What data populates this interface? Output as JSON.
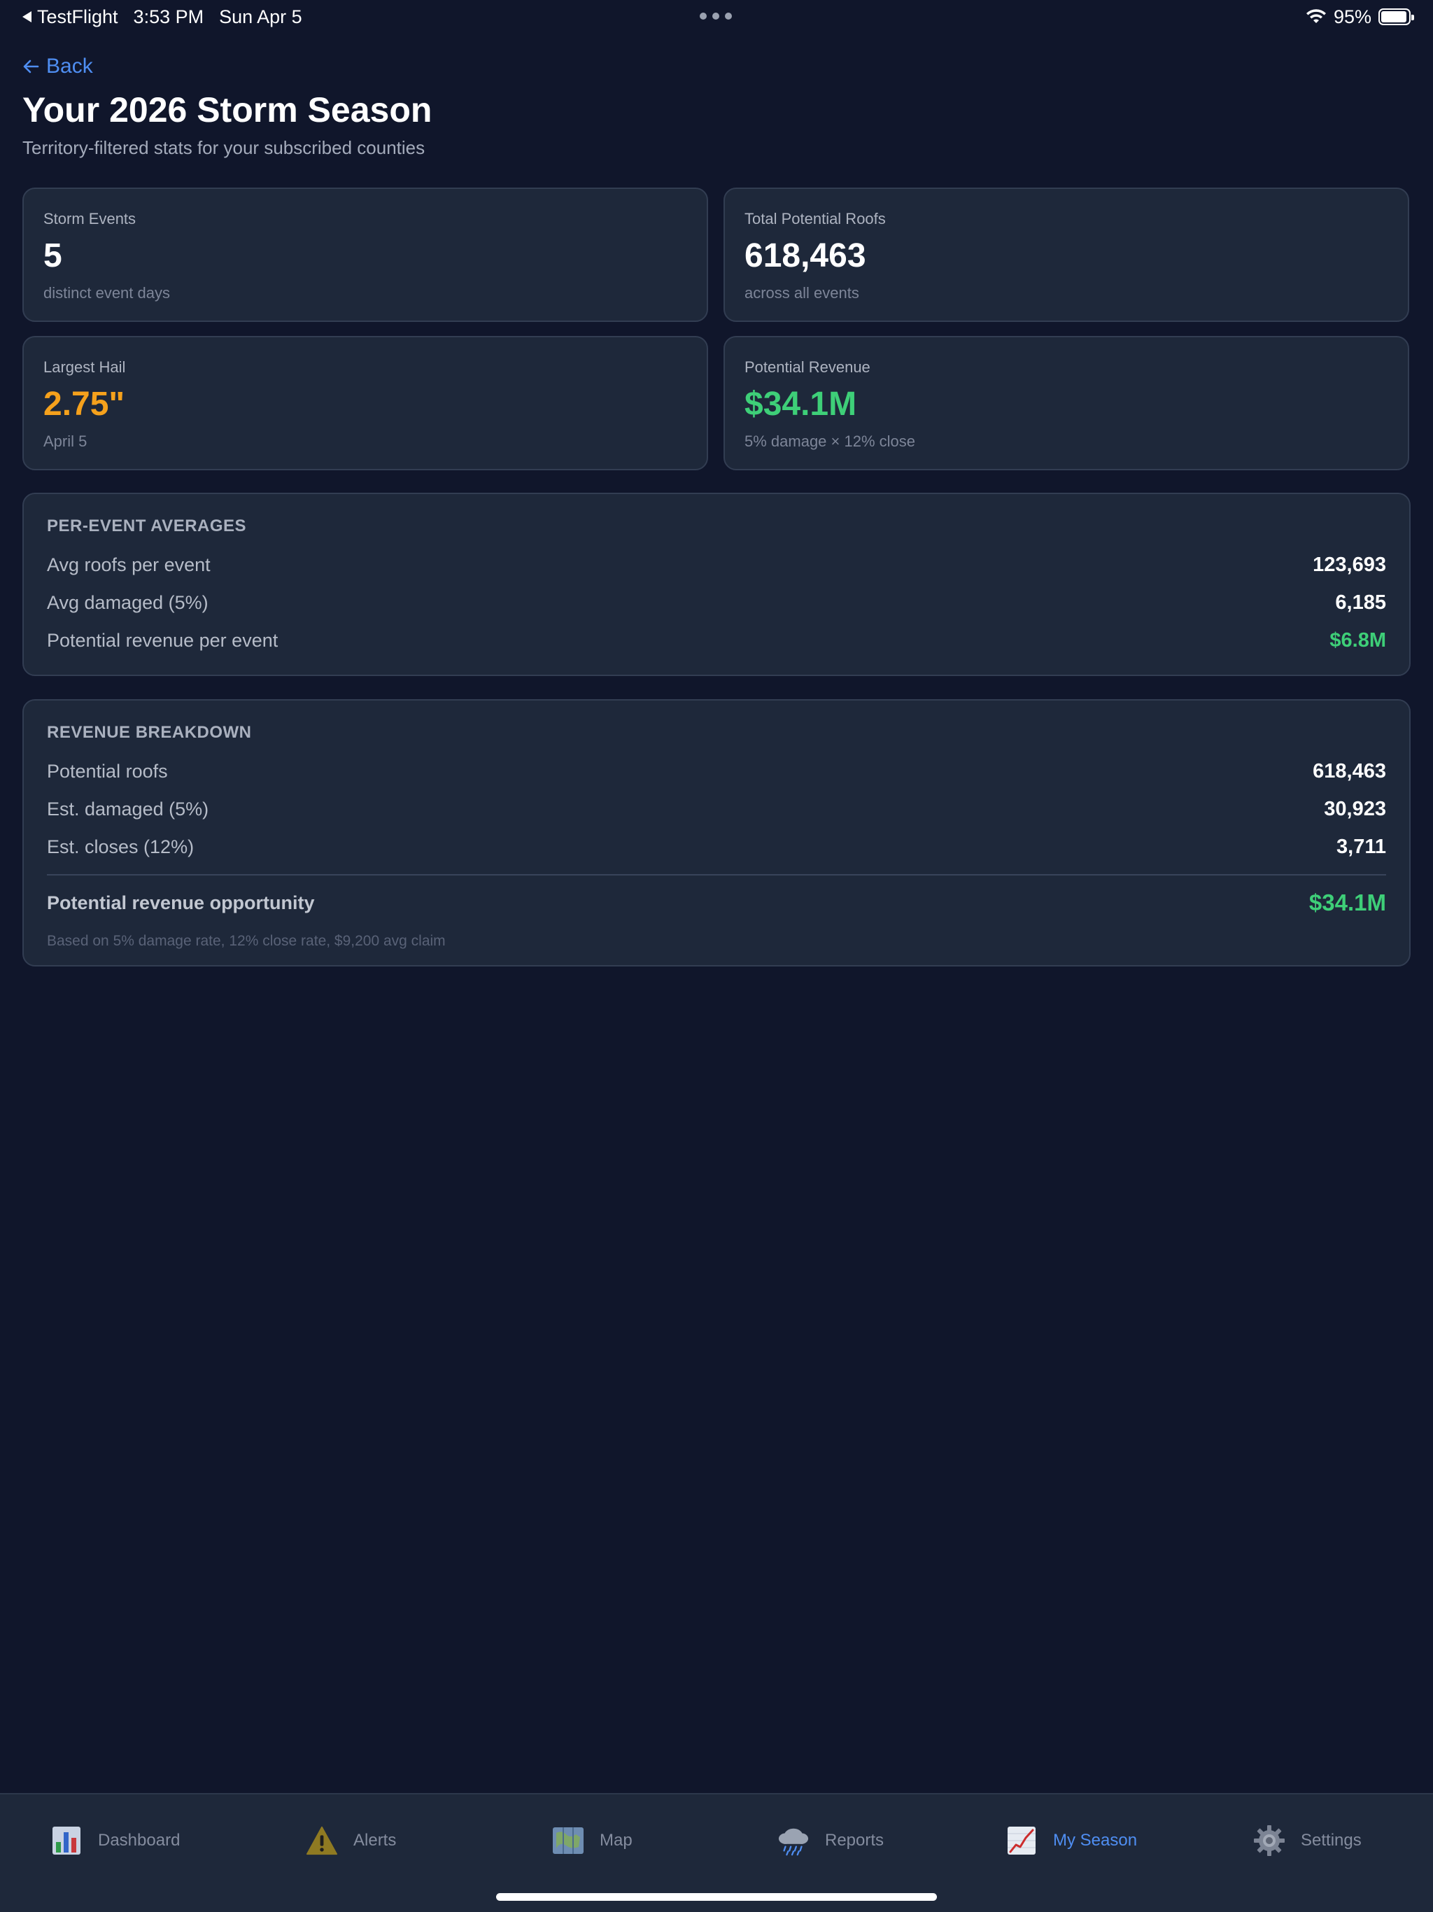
{
  "status_bar": {
    "app": "TestFlight",
    "time": "3:53 PM",
    "date": "Sun Apr 5",
    "battery": "95%",
    "battery_level": 0.95
  },
  "header": {
    "back_label": "Back",
    "title": "Your 2026 Storm Season",
    "subtitle": "Territory-filtered stats for your subscribed counties"
  },
  "stats": [
    {
      "label": "Storm Events",
      "value": "5",
      "note": "distinct event days"
    },
    {
      "label": "Total Potential Roofs",
      "value": "618,463",
      "note": "across all events"
    },
    {
      "label": "Largest Hail",
      "value": "2.75\"",
      "note": "April 5"
    },
    {
      "label": "Potential Revenue",
      "value": "$34.1M",
      "note": "5% damage × 12% close"
    }
  ],
  "per_event": {
    "heading": "PER-EVENT AVERAGES",
    "rows": [
      {
        "label": "Avg roofs per event",
        "value": "123,693"
      },
      {
        "label": "Avg damaged (5%)",
        "value": "6,185"
      },
      {
        "label": "Potential revenue per event",
        "value": "$6.8M"
      }
    ]
  },
  "revenue": {
    "heading": "REVENUE BREAKDOWN",
    "rows": [
      {
        "label": "Potential roofs",
        "value": "618,463"
      },
      {
        "label": "Est. damaged (5%)",
        "value": "30,923"
      },
      {
        "label": "Est. closes (12%)",
        "value": "3,711"
      }
    ],
    "total_label": "Potential revenue opportunity",
    "total_value": "$34.1M",
    "footnote": "Based on 5% damage rate, 12% close rate, $9,200 avg claim"
  },
  "tabs": [
    {
      "label": "Dashboard",
      "icon": "bar-chart-icon"
    },
    {
      "label": "Alerts",
      "icon": "warning-icon"
    },
    {
      "label": "Map",
      "icon": "map-icon"
    },
    {
      "label": "Reports",
      "icon": "rain-cloud-icon"
    },
    {
      "label": "My Season",
      "icon": "trend-chart-icon",
      "active": true
    },
    {
      "label": "Settings",
      "icon": "gear-icon"
    }
  ],
  "colors": {
    "background": "#10162b",
    "card": "#1e283a",
    "accent_blue": "#4f8ef2",
    "orange": "#f5a11c",
    "green": "#3ecf78"
  }
}
